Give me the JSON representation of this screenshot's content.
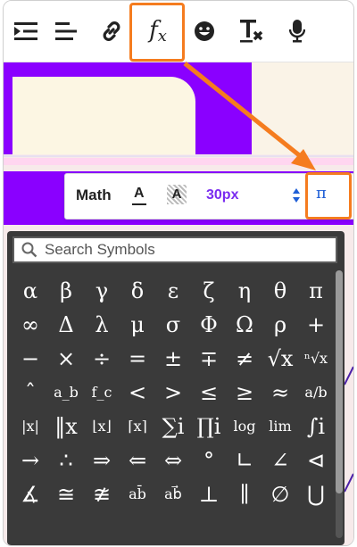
{
  "toolbar": {
    "buttons": [
      {
        "name": "indent-icon"
      },
      {
        "name": "align-left-icon"
      },
      {
        "name": "link-icon"
      },
      {
        "name": "formula-button",
        "label_main": "f",
        "label_sub": "x"
      },
      {
        "name": "emoji-icon"
      },
      {
        "name": "clear-format-icon",
        "label": "T"
      },
      {
        "name": "microphone-icon"
      }
    ]
  },
  "mathbar": {
    "label": "Math",
    "text_color_label": "A",
    "highlight_label": "A",
    "font_size": "30px",
    "pi_label": "π"
  },
  "search": {
    "placeholder": "Search Symbols"
  },
  "symbols": [
    "α",
    "β",
    "γ",
    "δ",
    "ε",
    "ζ",
    "η",
    "θ",
    "π",
    "∞",
    "Δ",
    "λ",
    "μ",
    "σ",
    "Φ",
    "Ω",
    "ρ",
    "+",
    "−",
    "×",
    "÷",
    "=",
    "±",
    "∓",
    "≠",
    "√x",
    "ⁿ√x",
    "ˆ",
    "a_b",
    "f_c",
    "<",
    ">",
    "≤",
    "≥",
    "≈",
    "a/b",
    "|x|",
    "‖x",
    "⌊x⌋",
    "⌈x⌉",
    "∑i",
    "∏i",
    "log",
    "lim",
    "∫i",
    "→",
    "∴",
    "⇒",
    "⇐",
    "⇔",
    "°",
    "∟",
    "∠",
    "⊲",
    "∡",
    "≅",
    "≇",
    "ab̄",
    "ab⃗",
    "⊥",
    "∥",
    "∅",
    "⋃"
  ],
  "colors": {
    "accent_orange": "#f57c1f",
    "purple": "#8a00ff",
    "cream": "#fcf6e3",
    "panel_bg": "#3a3a3a",
    "font_size_color": "#7a2cf0",
    "pi_color": "#1f5fd6"
  }
}
